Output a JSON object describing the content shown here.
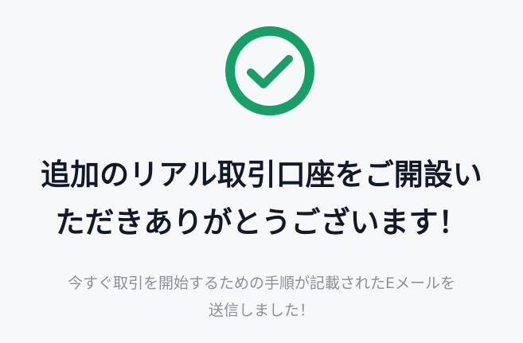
{
  "icons": {
    "success": "check-circle-icon"
  },
  "colors": {
    "accent": "#179f67",
    "title": "#121a2a",
    "message": "#8b9099",
    "background": "#f7f8fa"
  },
  "title": {
    "line1": "追加のリアル取引口座をご開設い",
    "line2": "ただきありがとうございます！"
  },
  "message": {
    "line1": "今すぐ取引を開始するための手順が記載されたEメールを",
    "line2": "送信しました！"
  }
}
